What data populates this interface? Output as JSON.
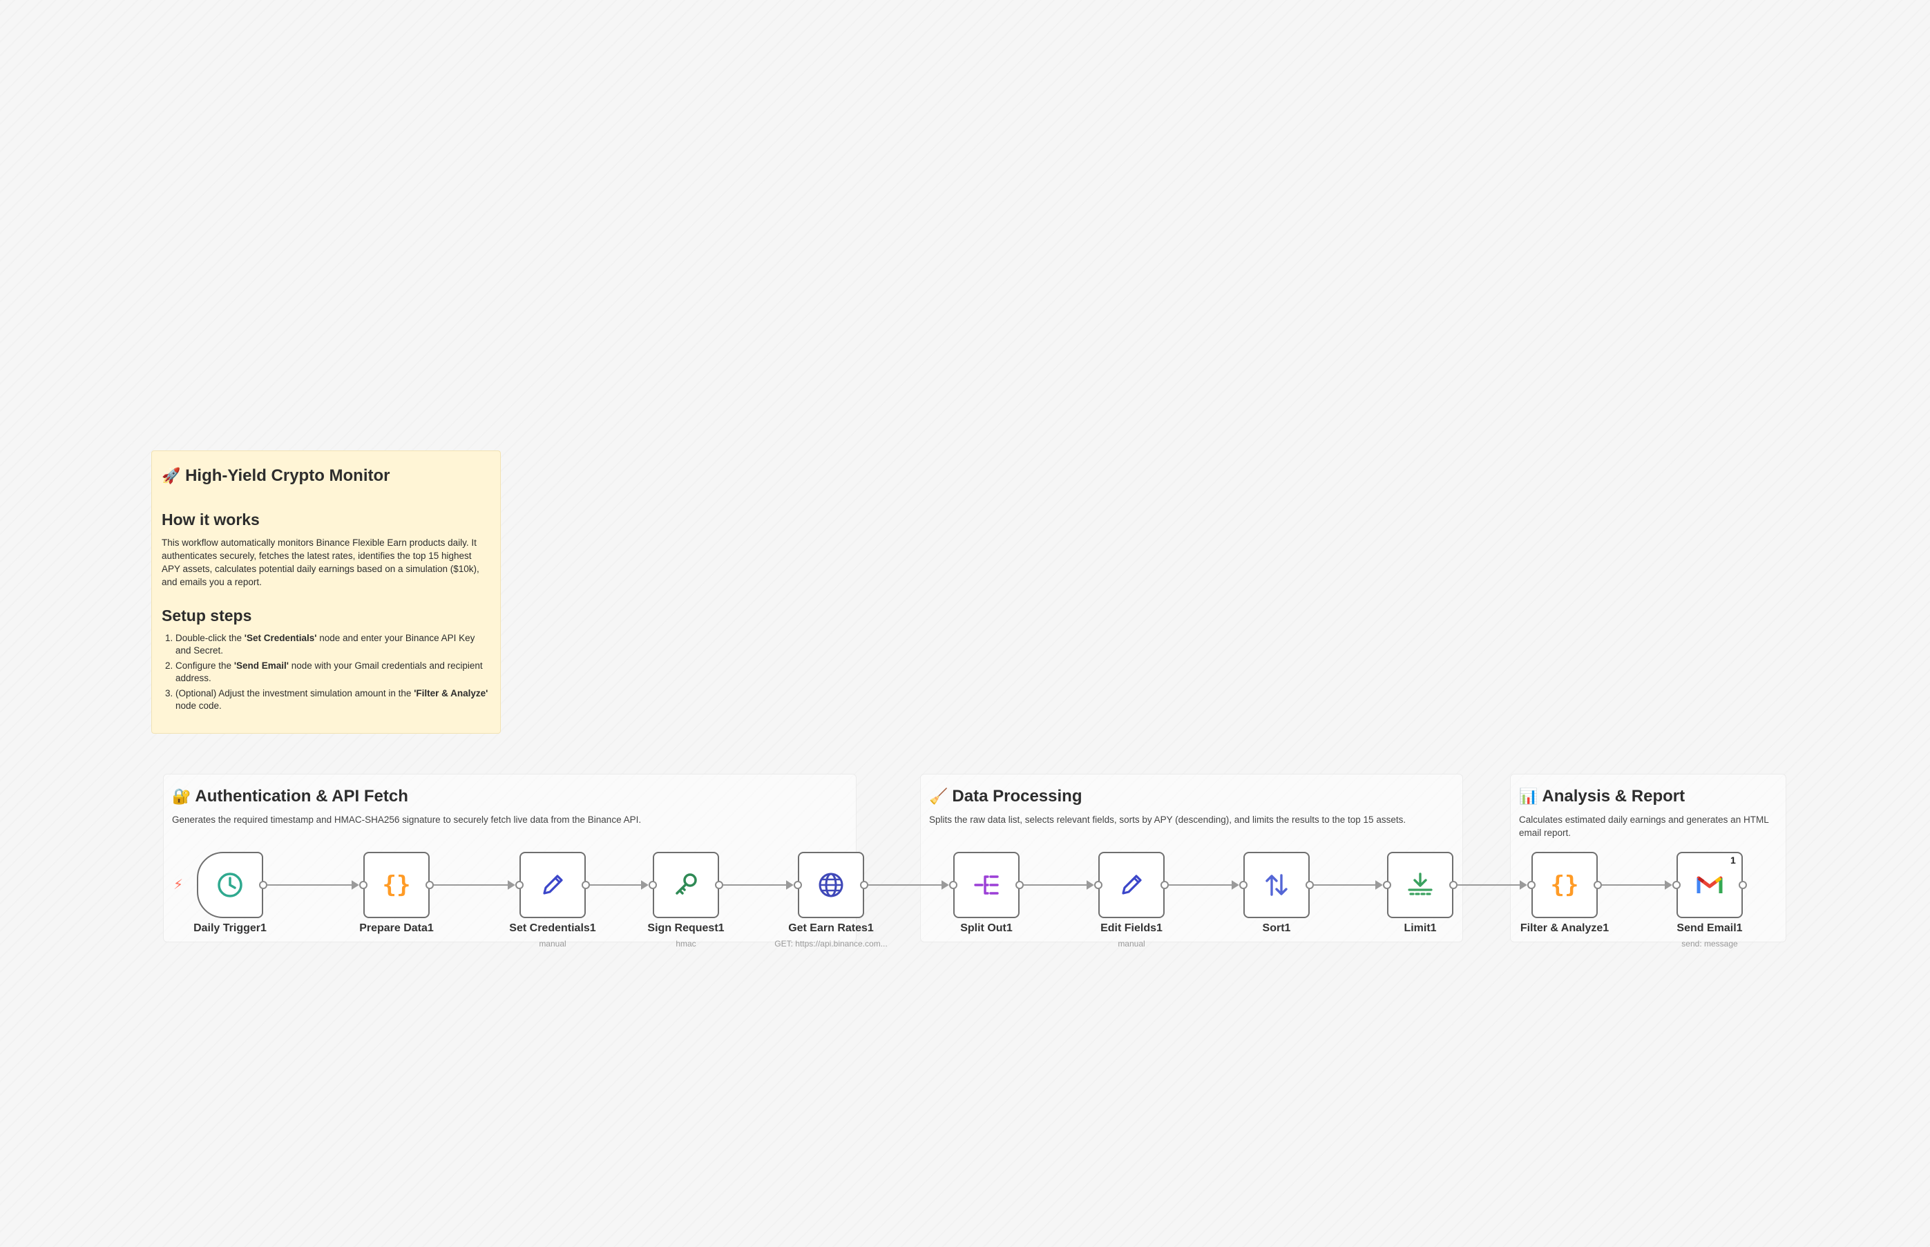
{
  "sticky_note": {
    "title_emoji": "🚀",
    "title": "High-Yield Crypto Monitor",
    "how_heading": "How it works",
    "how_text": "This workflow automatically monitors Binance Flexible Earn products daily. It authenticates securely, fetches the latest rates, identifies the top 15 highest APY assets, calculates potential daily earnings based on a simulation ($10k), and emails you a report.",
    "setup_heading": "Setup steps",
    "steps": [
      {
        "pre": "Double-click the ",
        "bold": "'Set Credentials'",
        "post": " node and enter your Binance API Key and Secret."
      },
      {
        "pre": "Configure the ",
        "bold": "'Send Email'",
        "post": " node with your Gmail credentials and recipient address."
      },
      {
        "pre": "(Optional) Adjust the investment simulation amount in the ",
        "bold": "'Filter & Analyze'",
        "post": " node code."
      }
    ]
  },
  "sections": [
    {
      "emoji": "🔐",
      "title": "Authentication & API Fetch",
      "description": "Generates the required timestamp and HMAC-SHA256 signature to securely fetch live data from the Binance API."
    },
    {
      "emoji": "🧹",
      "title": "Data Processing",
      "description": "Splits the raw data list, selects relevant fields, sorts by APY (descending), and limits the results to the top 15 assets."
    },
    {
      "emoji": "📊",
      "title": "Analysis & Report",
      "description": "Calculates estimated daily earnings and generates an HTML email report."
    }
  ],
  "nodes": [
    {
      "label": "Daily Trigger1",
      "subtitle": "",
      "icon": "clock-icon",
      "trigger": true
    },
    {
      "label": "Prepare Data1",
      "subtitle": "",
      "icon": "code-braces-icon"
    },
    {
      "label": "Set Credentials1",
      "subtitle": "manual",
      "icon": "pencil-icon"
    },
    {
      "label": "Sign Request1",
      "subtitle": "hmac",
      "icon": "key-icon"
    },
    {
      "label": "Get Earn Rates1",
      "subtitle": "GET: https://api.binance.com...",
      "icon": "globe-icon"
    },
    {
      "label": "Split Out1",
      "subtitle": "",
      "icon": "split-icon"
    },
    {
      "label": "Edit Fields1",
      "subtitle": "manual",
      "icon": "pencil-icon"
    },
    {
      "label": "Sort1",
      "subtitle": "",
      "icon": "sort-arrows-icon"
    },
    {
      "label": "Limit1",
      "subtitle": "",
      "icon": "limit-icon"
    },
    {
      "label": "Filter & Analyze1",
      "subtitle": "",
      "icon": "code-braces-icon"
    },
    {
      "label": "Send Email1",
      "subtitle": "send: message",
      "icon": "gmail-icon",
      "badge": "1"
    }
  ],
  "colors": {
    "trigger_bolt": "#ff6d5a",
    "code": "#ff9b26",
    "edit": "#3b46c9",
    "crypto": "#2f8a55",
    "http": "#3f48b8",
    "split": "#9b3fd6",
    "sort": "#5466d6",
    "limit": "#3aa15f"
  }
}
